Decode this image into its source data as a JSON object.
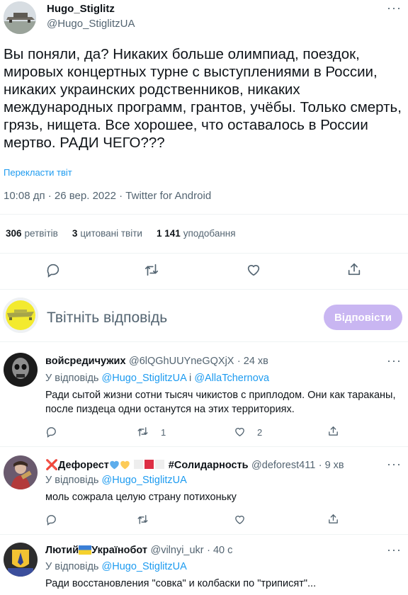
{
  "main_tweet": {
    "author_name": "Hugo_Stiglitz",
    "author_handle": "@Hugo_StiglitzUA",
    "more_label": "···",
    "text": "Вы поняли, да? Никаких больше олимпиад, поездок, мировых концертных турне с выступлениями в России, никаких украинских родственников, никаких международных программ, грантов, учёбы. Только смерть, грязь, нищета. Все хорошее, что оставалось в России мертво. РАДИ ЧЕГО???",
    "translate_label": "Перекласти твіт",
    "meta": "10:08 дп · 26 вер. 2022 · Twitter for Android",
    "stats": {
      "retweets_count": "306",
      "retweets_label": "ретвітів",
      "quotes_count": "3",
      "quotes_label": "цитовані твіти",
      "likes_count": "1 141",
      "likes_label": "уподобання"
    },
    "actions": [
      "reply-icon",
      "retweet-icon",
      "like-icon",
      "share-icon"
    ]
  },
  "composer": {
    "placeholder": "Твітніть відповідь",
    "reply_button": "Відповісти"
  },
  "replies": [
    {
      "name": "войсредичужих",
      "handle": "@6lQGhUUYneGQXjX",
      "time": "· 24 хв",
      "reply_to_prefix": "У відповідь",
      "reply_to_1": "@Hugo_StiglitzUA",
      "reply_to_join": "і",
      "reply_to_2": "@AllaTchernova",
      "text": "Ради сытой жизни сотни тысяч чикистов с приплодом. Они как тараканы, после пиздеца одни останутся на этих территориях.",
      "retweets": "1",
      "likes": "2"
    },
    {
      "name": "❌Дефорест",
      "hashtag": "#Солидарность",
      "handle": "@deforest411",
      "time": "· 9 хв",
      "reply_to_prefix": "У відповідь",
      "reply_to_1": "@Hugo_StiglitzUA",
      "text": "моль сожрала целую страну потихоньку"
    },
    {
      "name": "Лютий",
      "name_suffix": "Українобот",
      "handle": "@vilnyi_ukr",
      "time": "· 40 с",
      "reply_to_prefix": "У відповідь",
      "reply_to_1": "@Hugo_StiglitzUA",
      "text": "Ради восстановления  \"совка\" и колбаски по \"триписят\"..."
    }
  ],
  "colors": {
    "link": "#1d9bf0",
    "muted": "#536471",
    "button_disabled": "#c9b6f2"
  }
}
